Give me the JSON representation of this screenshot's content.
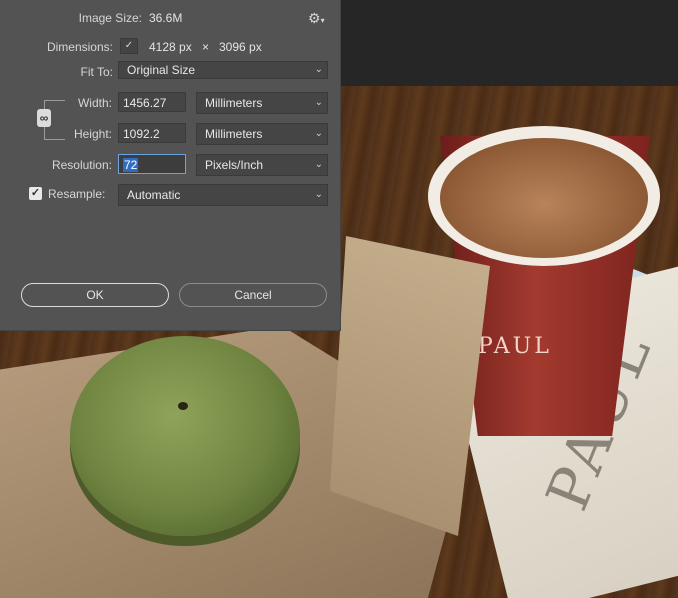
{
  "dialog": {
    "image_size_label": "Image Size:",
    "image_size_value": "36.6M",
    "dimensions_label": "Dimensions:",
    "dimensions_width": "4128 px",
    "dimensions_times": "×",
    "dimensions_height": "3096 px",
    "fit_to_label": "Fit To:",
    "fit_to_value": "Original Size",
    "width_label": "Width:",
    "width_value": "1456.27",
    "width_unit": "Millimeters",
    "height_label": "Height:",
    "height_value": "1092.2",
    "height_unit": "Millimeters",
    "resolution_label": "Resolution:",
    "resolution_value": "72",
    "resolution_unit": "Pixels/Inch",
    "resample_label": "Resample:",
    "resample_checked": true,
    "resample_value": "Automatic",
    "ok_label": "OK",
    "cancel_label": "Cancel"
  },
  "photo": {
    "cup_logo": "PAUL",
    "napkin_logo": "PAUL"
  },
  "icons": {
    "settings": "gear-icon",
    "dimensions_toggle": "chevron-down-icon",
    "constrain": "link-icon",
    "checkbox": "check-icon"
  },
  "colors": {
    "dialog_bg": "#535353",
    "field_bg": "#454545",
    "focus_border": "#6aa3e0",
    "selection": "#2f6cc3"
  }
}
